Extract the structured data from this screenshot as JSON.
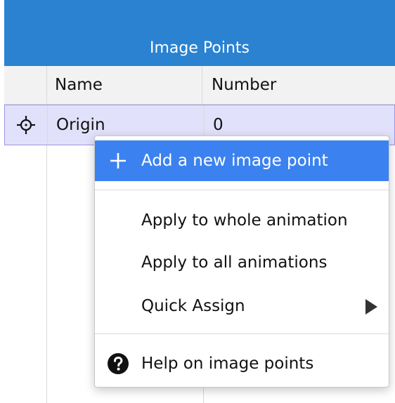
{
  "panel": {
    "title": "Image Points"
  },
  "table": {
    "columns": {
      "icon": "",
      "name": "Name",
      "number": "Number"
    },
    "rows": [
      {
        "icon": "crosshair-icon",
        "name": "Origin",
        "number": "0"
      }
    ]
  },
  "context_menu": {
    "items": [
      {
        "label": "Add a new image point",
        "icon": "plus-icon",
        "selected": true
      },
      {
        "label": "Apply to whole animation"
      },
      {
        "label": "Apply to all animations"
      },
      {
        "label": "Quick Assign",
        "submenu": true
      },
      {
        "label": "Help on image points",
        "icon": "help-icon"
      }
    ]
  },
  "colors": {
    "header_blue": "#2a82d1",
    "selected_row": "#e2e1fb",
    "menu_highlight": "#3b82f0"
  }
}
